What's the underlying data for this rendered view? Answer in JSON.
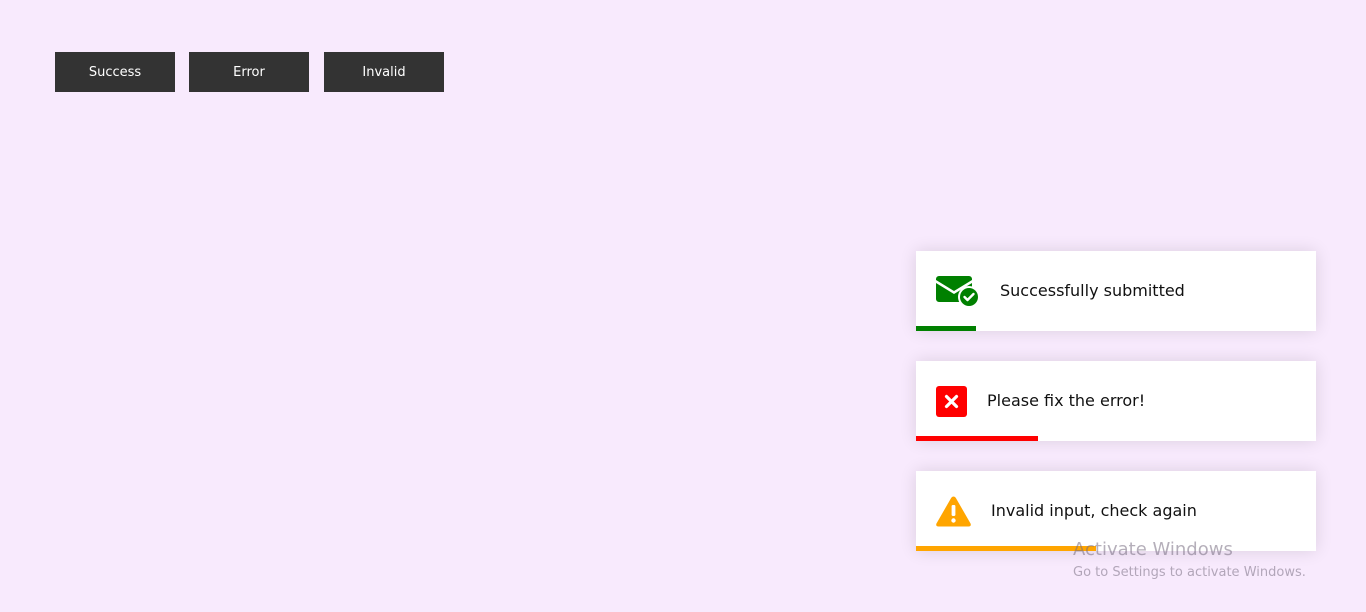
{
  "buttons": {
    "success_label": "Success",
    "error_label": "Error",
    "invalid_label": "Invalid"
  },
  "toasts": [
    {
      "type": "success",
      "icon": "envelope-check-icon",
      "message": "Successfully submitted",
      "color": "#008000",
      "progress": 0.15
    },
    {
      "type": "error",
      "icon": "error-x-icon",
      "message": "Please fix the error!",
      "color": "#ff0000",
      "progress": 0.305
    },
    {
      "type": "invalid",
      "icon": "warning-triangle-icon",
      "message": "Invalid input, check again",
      "color": "#ffa500",
      "progress": 0.45
    }
  ],
  "watermark": {
    "title": "Activate Windows",
    "subtitle": "Go to Settings to activate Windows."
  },
  "colors": {
    "background": "#f8eafd",
    "button_bg": "#333333",
    "button_text": "#ffffff"
  }
}
